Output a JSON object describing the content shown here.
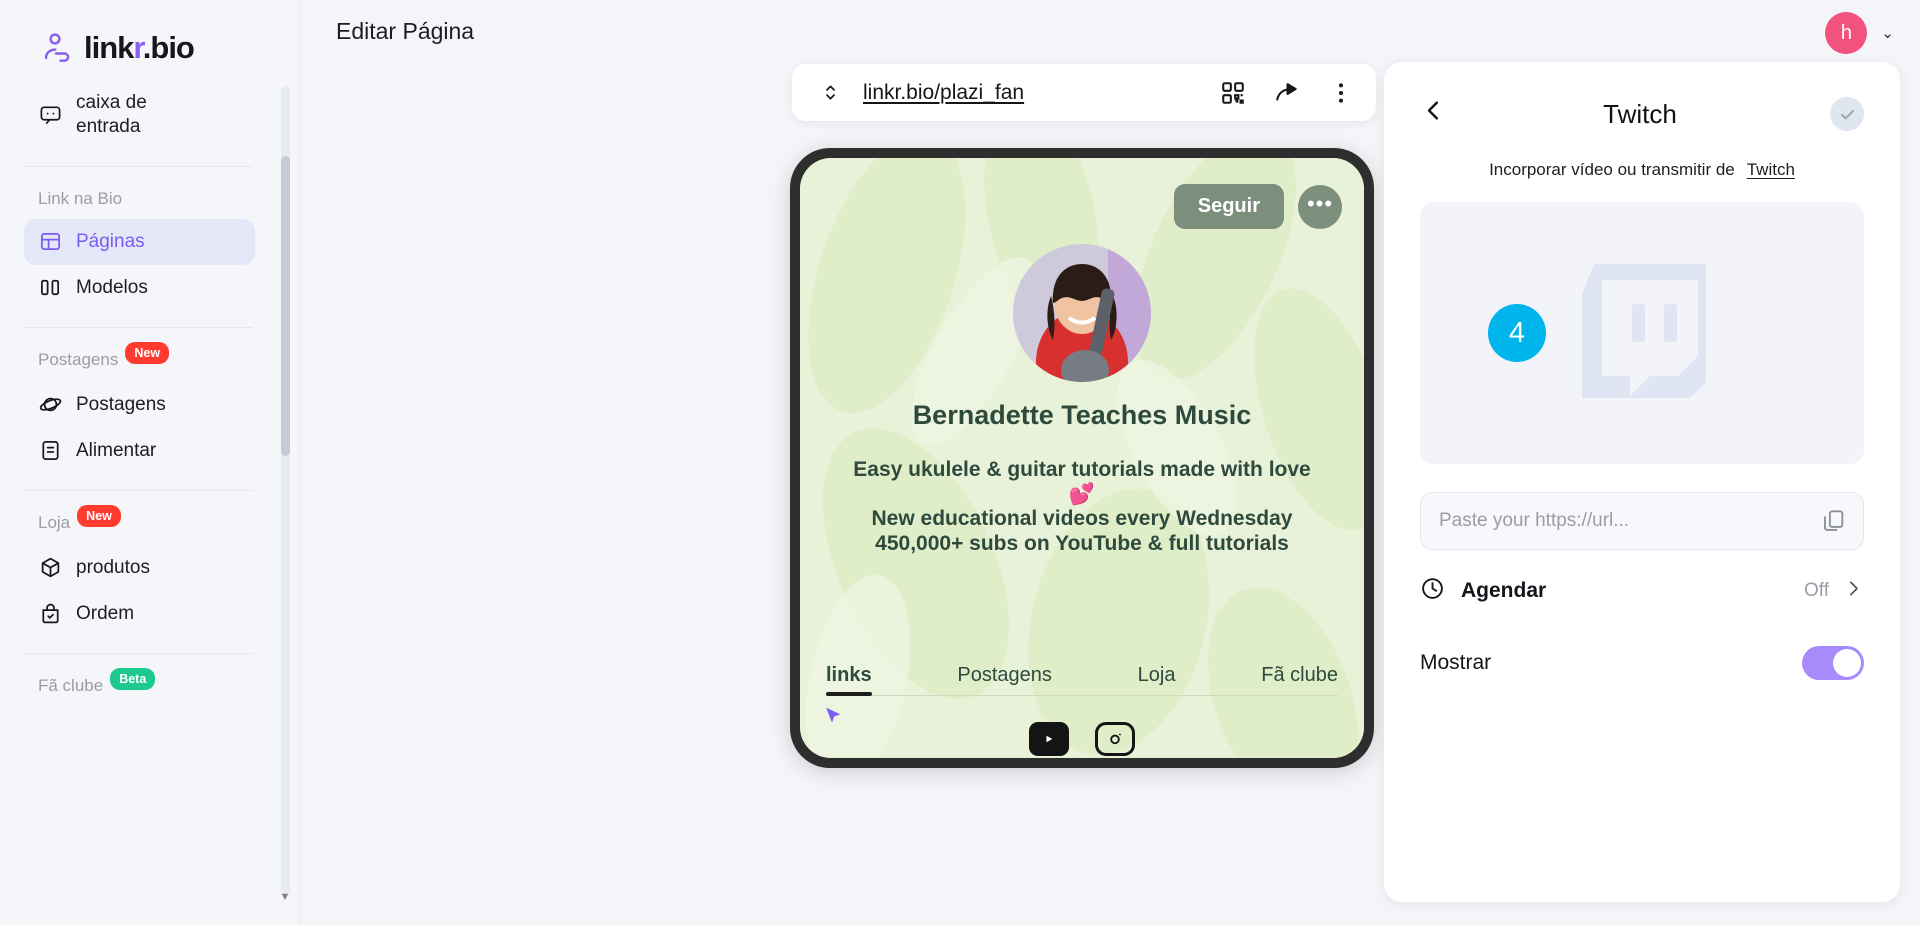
{
  "brand": {
    "name_plain": "link",
    "name_accent": "r",
    "name_suffix": ".bio"
  },
  "sidebar": {
    "inbox": {
      "label": "caixa de entrada",
      "icon": "chat-bubble-icon"
    },
    "groups": [
      {
        "label": "Link na Bio",
        "badge": null,
        "items": [
          {
            "label": "Páginas",
            "icon": "layout-icon",
            "active": true
          },
          {
            "label": "Modelos",
            "icon": "columns-icon",
            "active": false
          }
        ]
      },
      {
        "label": "Postagens",
        "badge": "New",
        "badge_kind": "new",
        "items": [
          {
            "label": "Postagens",
            "icon": "planet-icon",
            "active": false
          },
          {
            "label": "Alimentar",
            "icon": "feed-icon",
            "active": false
          }
        ]
      },
      {
        "label": "Loja",
        "badge": "New",
        "badge_kind": "new",
        "items": [
          {
            "label": "produtos",
            "icon": "box-icon",
            "active": false
          },
          {
            "label": "Ordem",
            "icon": "bag-check-icon",
            "active": false
          }
        ]
      },
      {
        "label": "Fã clube",
        "badge": "Beta",
        "badge_kind": "beta",
        "items": []
      }
    ]
  },
  "header": {
    "title": "Editar Página",
    "avatar_initial": "h",
    "avatar_color": "#f2527e"
  },
  "url_bar": {
    "url": "linkr.bio/plazi_fan",
    "icons": [
      "qr-code-icon",
      "share-icon",
      "more-vertical-icon"
    ]
  },
  "preview": {
    "follow_button": "Seguir",
    "more_button": "•••",
    "profile_name": "Bernadette Teaches Music",
    "bio": "Easy ukulele & guitar tutorials made with love 💕\nNew educational videos every Wednesday\n450,000+ subs on YouTube & full tutorials",
    "tabs": [
      {
        "label": "links",
        "active": true
      },
      {
        "label": "Postagens",
        "active": false
      },
      {
        "label": "Loja",
        "active": false
      },
      {
        "label": "Fã clube",
        "active": false
      }
    ],
    "socials": [
      "youtube-icon",
      "instagram-icon"
    ],
    "bg_color": "#e5f0d2",
    "text_color": "#2e4a3d"
  },
  "panel": {
    "title": "Twitch",
    "back_icon": "chevron-left-icon",
    "confirm_icon": "check-icon",
    "subtitle": "Incorporar vídeo ou transmitir de",
    "subtitle_link": "Twitch",
    "step_number": "4",
    "embed_icon": "twitch-icon",
    "input_placeholder": "Paste your https://url...",
    "input_value": "",
    "copy_icon": "clipboard-icon",
    "rows": [
      {
        "label": "Agendar",
        "icon": "clock-icon",
        "value": "Off",
        "control": "chevron",
        "bold": true
      },
      {
        "label": "Mostrar",
        "icon": null,
        "value": "",
        "control": "toggle",
        "toggle_on": true,
        "bold": false
      }
    ],
    "accent_color": "#a78bfa",
    "step_badge_color": "#00b4ec"
  }
}
